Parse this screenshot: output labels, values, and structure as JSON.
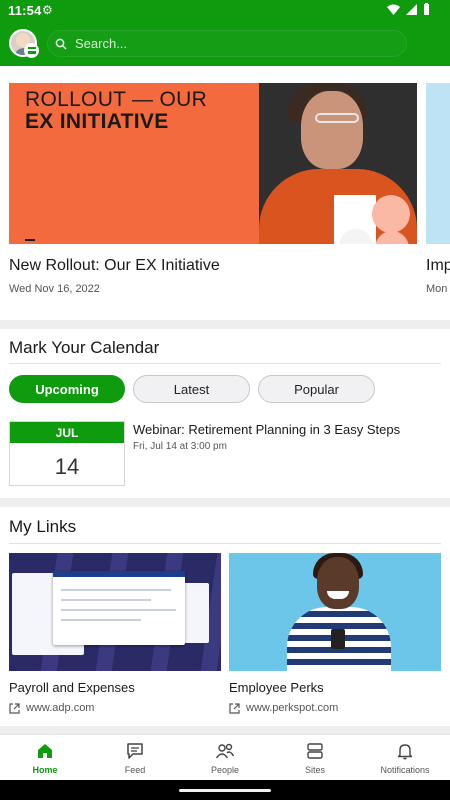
{
  "status_bar": {
    "time": "11:54"
  },
  "search": {
    "placeholder": "Search..."
  },
  "carousel": {
    "items": [
      {
        "banner_line1": "ROLLOUT — OUR",
        "banner_line2": "EX INITIATIVE",
        "title": "New Rollout: Our EX Initiative",
        "date": "Wed Nov 16, 2022"
      },
      {
        "title": "Imp",
        "date": "Mon"
      }
    ]
  },
  "calendar": {
    "title": "Mark Your Calendar",
    "tabs": [
      "Upcoming",
      "Latest",
      "Popular"
    ],
    "active_tab": "Upcoming",
    "events": [
      {
        "month": "JUL",
        "day": "14",
        "title": "Webinar: Retirement Planning in 3 Easy Steps",
        "time": "Fri, Jul 14 at 3:00 pm"
      }
    ]
  },
  "links": {
    "title": "My Links",
    "items": [
      {
        "title": "Payroll and Expenses",
        "url": "www.adp.com"
      },
      {
        "title": "Employee Perks",
        "url": "www.perkspot.com"
      }
    ]
  },
  "bottom_nav": {
    "items": [
      {
        "label": "Home",
        "icon": "home-icon"
      },
      {
        "label": "Feed",
        "icon": "chat-icon"
      },
      {
        "label": "People",
        "icon": "people-icon"
      },
      {
        "label": "Sites",
        "icon": "sites-icon"
      },
      {
        "label": "Notifications",
        "icon": "bell-icon"
      }
    ],
    "active": "Home"
  },
  "colors": {
    "brand_green": "#0e9b0e",
    "banner_orange": "#f26a3d"
  }
}
